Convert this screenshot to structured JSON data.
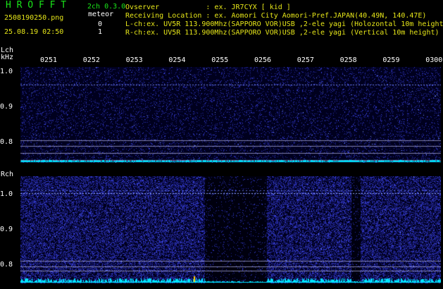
{
  "header": {
    "app_title": "H R O F F T",
    "channel_mode": "2ch 0.3.0",
    "filename": "2508190250.png",
    "meteor_label": "meteor",
    "timestamp": "25.08.19 02:50",
    "lch_count": "0",
    "rch_count": "1",
    "observer_line": "Ovserver           : ex. JR7CYX [ kid ]",
    "location_line": "Receiving Location : ex. Aomori City Aomori-Pref.JAPAN(40.49N, 140.47E)",
    "lch_line": "L-ch:ex. UV5R 113.900Mhz(SAPPORO VOR)USB ,2-ele yagi (Holozontal 10m height)",
    "rch_line": "R-ch:ex. UV5R 113.900Mhz(SAPPORO VOR)USB ,2-ele yagi (Vertical 10m height)"
  },
  "lch_panel": {
    "label": "Lch",
    "unit": "kHz",
    "y_ticks": [
      "1.0",
      "0.9",
      "0.8"
    ],
    "time_ticks": [
      "0251",
      "0252",
      "0253",
      "0254",
      "0255",
      "0256",
      "0257",
      "0258",
      "0259",
      "0300"
    ]
  },
  "rch_panel": {
    "label": "Rch",
    "y_ticks": [
      "1.0",
      "0.9",
      "0.8"
    ]
  },
  "colors": {
    "title_green": "#19e619",
    "meteor_yellow": "#e6e619",
    "noise_blue": "#2a2aa0",
    "trace_cyan": "#00ffff",
    "panel_bg": "#000030"
  }
}
